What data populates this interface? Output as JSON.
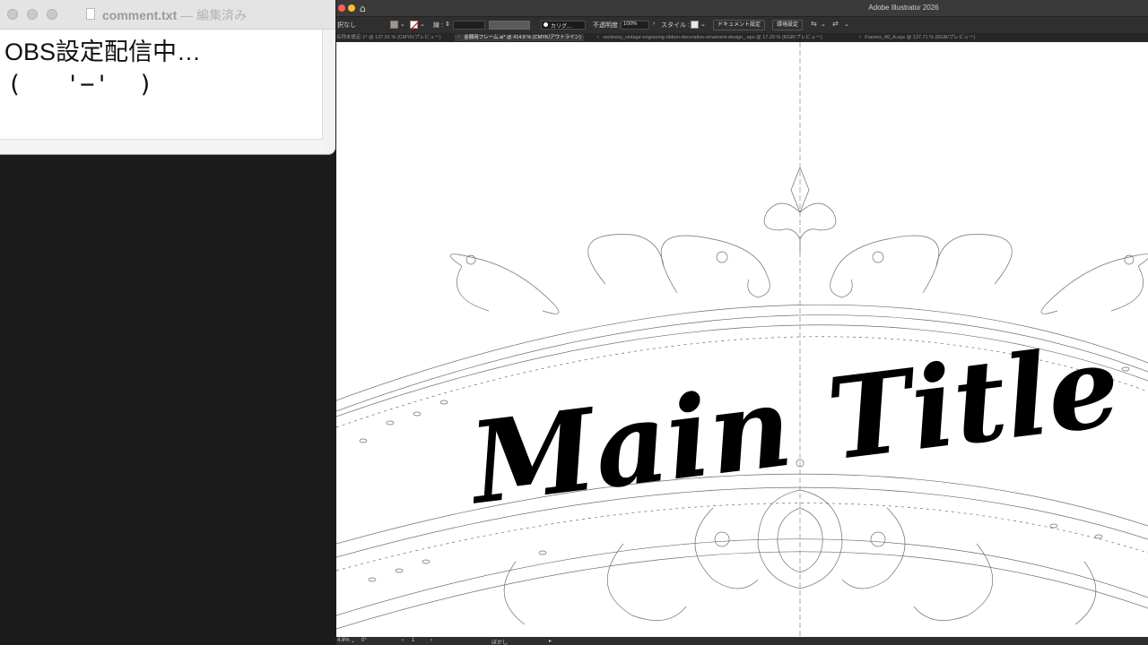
{
  "editor": {
    "title": "comment.txt",
    "subtitle": "— 編集済み",
    "line1": "OBS設定配信中…",
    "line2": "(   '−'  )"
  },
  "illustrator": {
    "app_title": "Adobe Illustrator 2026",
    "control_bar": {
      "selection_label": "択なし",
      "stroke_label": "線 :",
      "brush_label": "カリグ...",
      "opacity_label": "不透明度 :",
      "opacity_value": "100%",
      "style_label": "スタイル :",
      "document_setup_button": "ドキュメント設定",
      "preferences_button": "環境設定",
      "fill_color": "#a1958c",
      "stroke_color": "#ffffff"
    },
    "tabs": [
      {
        "label": "名称未設定-1* @ 137.01 % (CMYK/プレビュー)",
        "active": false
      },
      {
        "label": "金額用フレーム.ai* @ 414.8 % (CMYK/アウトライン)",
        "active": true
      },
      {
        "label": "vecteezy_vintage-engraving-ribbon-decorative-ornament-design_.eps @ 17.29 % (RGB/プレビュー)",
        "active": false
      },
      {
        "label": "Frames_40_A.eps @ 137.71 % (RGB/プレビュー)",
        "active": false
      }
    ],
    "artwork_text": "Main Title",
    "status": {
      "zoom": "4.8%",
      "rotation": "0°",
      "artboard": "1",
      "tool": "ぼかし"
    }
  }
}
